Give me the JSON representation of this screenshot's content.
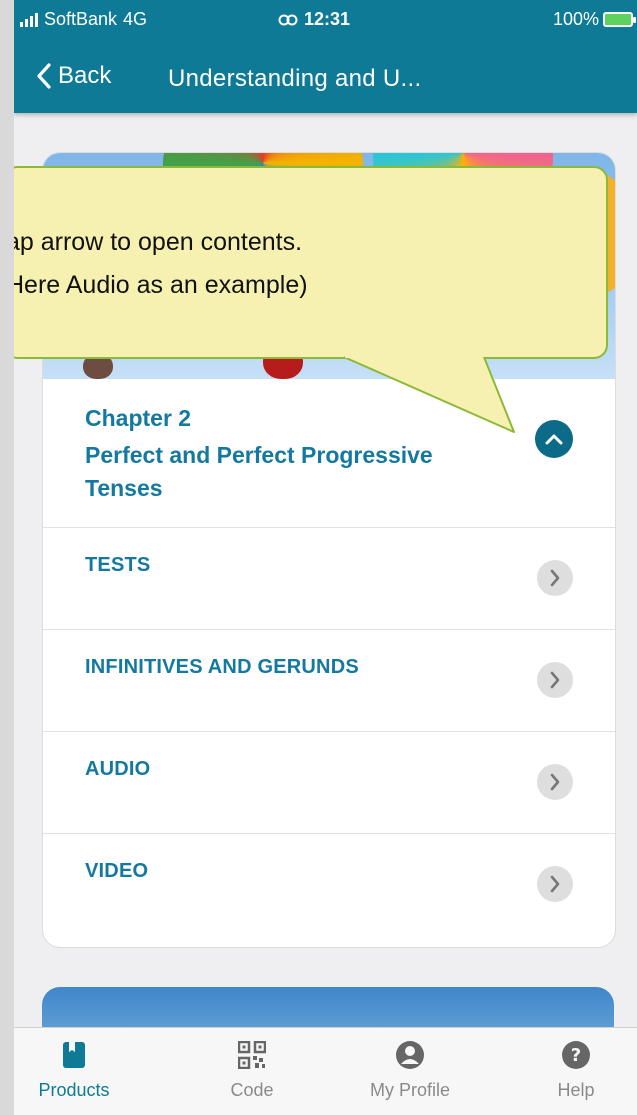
{
  "status_bar": {
    "carrier": "SoftBank",
    "network": "4G",
    "time": "12:31",
    "battery": "100%"
  },
  "nav": {
    "back_label": "Back",
    "title": "Understanding and U..."
  },
  "callout": {
    "line1": "ap arrow to open contents.",
    "line2": "Here Audio as an example)"
  },
  "chapter": {
    "number": "Chapter 2",
    "name": "Perfect and Perfect Progressive Tenses"
  },
  "sections": [
    {
      "label": "TESTS"
    },
    {
      "label": "INFINITIVES AND GERUNDS"
    },
    {
      "label": "AUDIO"
    },
    {
      "label": "VIDEO"
    }
  ],
  "tabs": [
    {
      "label": "Products",
      "icon": "book-icon",
      "active": true
    },
    {
      "label": "Code",
      "icon": "qr-code-icon",
      "active": false
    },
    {
      "label": "My Profile",
      "icon": "profile-icon",
      "active": false
    },
    {
      "label": "Help",
      "icon": "help-icon",
      "active": false
    }
  ],
  "colors": {
    "brand": "#0e7a95",
    "link": "#1479a0",
    "callout_fill": "#f6f1b0",
    "callout_border": "#8db93a"
  }
}
